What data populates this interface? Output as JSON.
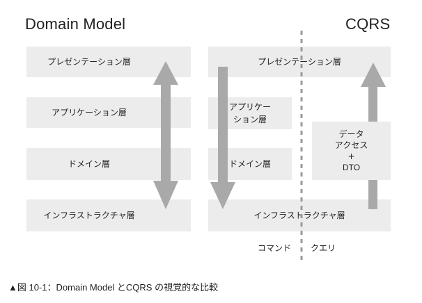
{
  "titles": {
    "left": "Domain Model",
    "right": "CQRS"
  },
  "left_layers": {
    "presentation": "プレゼンテーション層",
    "application": "アプリケーション層",
    "domain": "ドメイン層",
    "infrastructure": "インフラストラクチャ層"
  },
  "right_layers": {
    "presentation": "プレゼンテーション層",
    "application_line1": "アプリケー",
    "application_line2": "ション層",
    "domain": "ドメイン層",
    "data_access_line1": "データ",
    "data_access_line2": "アクセス",
    "data_access_line3": "+",
    "data_access_line4": "DTO",
    "infrastructure": "インフラストラクチャ層"
  },
  "side_labels": {
    "command": "コマンド",
    "query": "クエリ"
  },
  "caption": "▲図 10-1：Domain Model とCQRS の視覚的な比較",
  "colors": {
    "box": "#ececec",
    "arrow": "#a9a9a9",
    "divider": "#9a9a9a"
  }
}
